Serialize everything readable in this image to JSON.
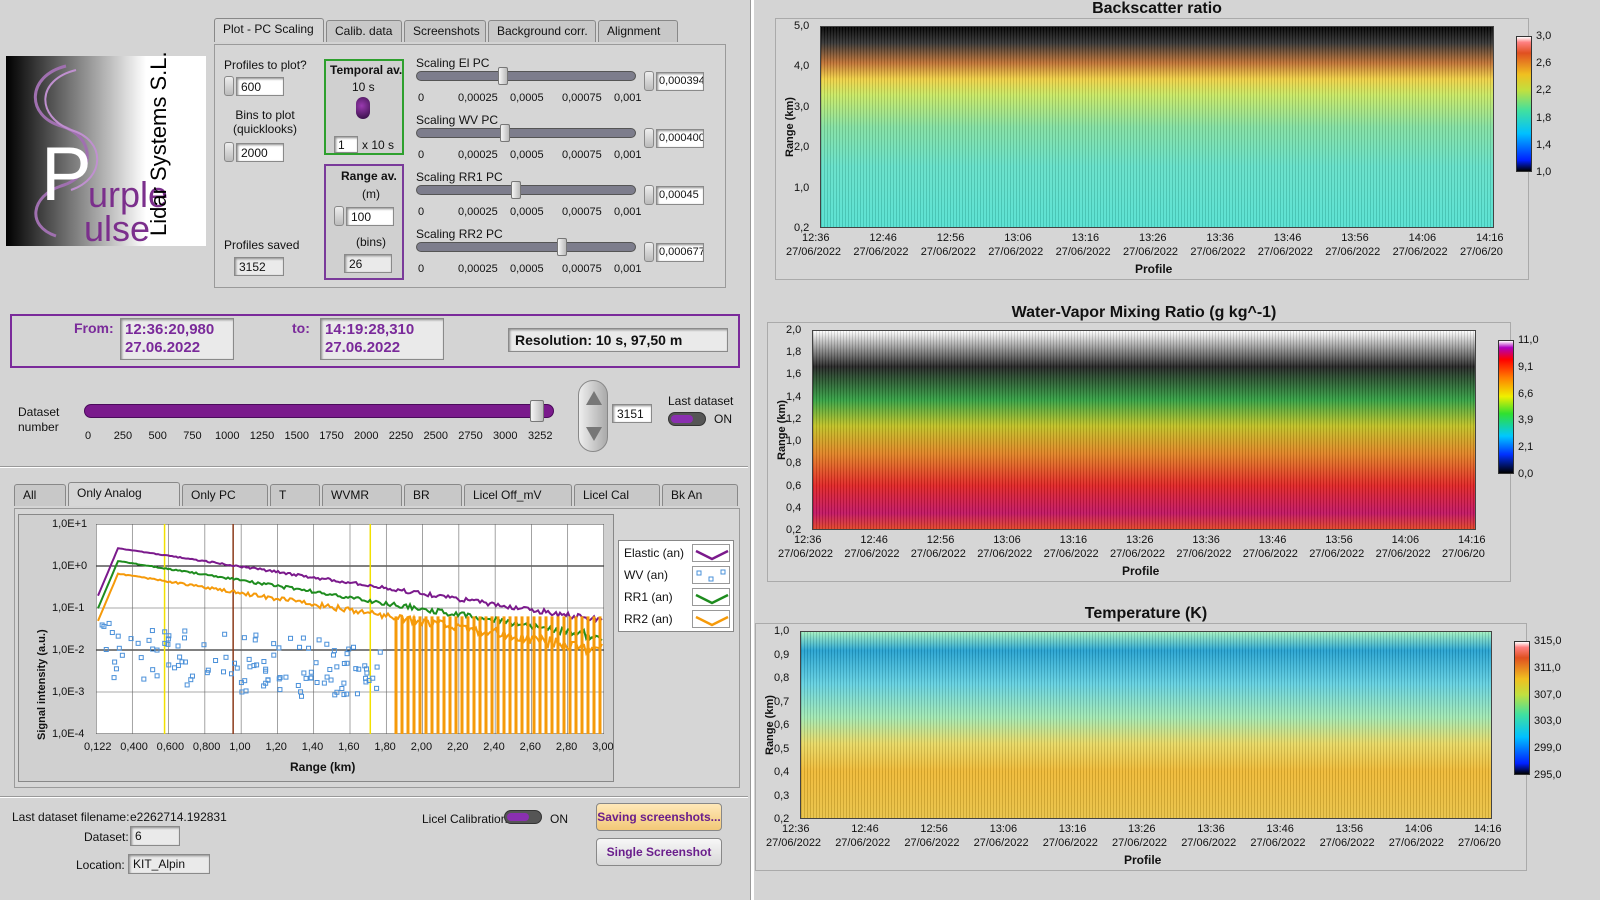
{
  "brand": {
    "logo_line1": "urple",
    "logo_line2": "ulse",
    "logo_letter": "P",
    "company": "Lidar Systems S.L."
  },
  "tabs_top": [
    "Plot - PC Scaling",
    "Calib. data",
    "Screenshots",
    "Background corr.",
    "Alignment"
  ],
  "controls": {
    "profiles_to_plot_label": "Profiles to plot?",
    "profiles_to_plot": "600",
    "bins_to_plot_label": "Bins to plot (quicklooks)",
    "bins_to_plot": "2000",
    "profiles_saved_label": "Profiles saved",
    "profiles_saved": "3152",
    "temporal_av_label": "Temporal av.",
    "temporal_av_value": "10 s",
    "temporal_av_count": "1",
    "temporal_av_unit": "x 10 s",
    "range_av_label": "Range av.",
    "range_av_unit_m": "(m)",
    "range_av_m": "100",
    "range_av_unit_bins": "(bins)",
    "range_av_bins": "26"
  },
  "scalings": [
    {
      "label": "Scaling El PC",
      "value": "0,000394",
      "fraction": 0.39
    },
    {
      "label": "Scaling WV PC",
      "value": "0,000400",
      "fraction": 0.4
    },
    {
      "label": "Scaling RR1 PC",
      "value": "0,00045",
      "fraction": 0.45
    },
    {
      "label": "Scaling RR2 PC",
      "value": "0,000677",
      "fraction": 0.67
    }
  ],
  "scaling_ticks": [
    "0",
    "0,00025",
    "0,0005",
    "0,00075",
    "0,001"
  ],
  "time_range": {
    "from_label": "From:",
    "from_time": "12:36:20,980",
    "from_date": "27.06.2022",
    "to_label": "to:",
    "to_time": "14:19:28,310",
    "to_date": "27.06.2022",
    "resolution": "Resolution: 10 s, 97,50 m"
  },
  "dataset": {
    "label": "Dataset number",
    "value": "3151",
    "max": 3252,
    "ticks": [
      "0",
      "250",
      "500",
      "750",
      "1000",
      "1250",
      "1500",
      "1750",
      "2000",
      "2250",
      "2500",
      "2750",
      "3000",
      "3252"
    ],
    "last_label": "Last dataset",
    "last_state": "ON"
  },
  "tabs_bottom": [
    "All",
    "Only Analog",
    "Only PC",
    "T",
    "WVMR",
    "BR",
    "Licel Off_mV",
    "Licel Cal",
    "Bk An"
  ],
  "signal_plot": {
    "ylabel": "Signal intensity (a.u.)",
    "xlabel": "Range (km)",
    "yticks": [
      "1,0E+1",
      "1,0E+0",
      "1,0E-1",
      "1,0E-2",
      "1,0E-3",
      "1,0E-4"
    ],
    "xticks": [
      "0,122",
      "0,400",
      "0,600",
      "0,800",
      "1,00",
      "1,20",
      "1,40",
      "1,60",
      "1,80",
      "2,00",
      "2,20",
      "2,40",
      "2,60",
      "2,80",
      "3,00"
    ],
    "legend": [
      {
        "name": "Elastic (an)",
        "color": "#7b1a8c"
      },
      {
        "name": "WV (an)",
        "color": "#4a90d9"
      },
      {
        "name": "RR1 (an)",
        "color": "#1e8c1e"
      },
      {
        "name": "RR2 (an)",
        "color": "#f59a0a"
      }
    ]
  },
  "footer": {
    "filename_label": "Last dataset filename:",
    "filename": "e2262714.192831",
    "dataset_label": "Dataset:",
    "dataset": "6",
    "location_label": "Location:",
    "location": "KIT_Alpin",
    "licel_label": "Licel Calibration",
    "licel_state": "ON",
    "saving_btn": "Saving screenshots...",
    "single_btn": "Single Screenshot"
  },
  "time_ticks": [
    "12:36",
    "12:46",
    "12:56",
    "13:06",
    "13:16",
    "13:26",
    "13:36",
    "13:46",
    "13:56",
    "14:06",
    "14:16"
  ],
  "time_date": "27/06/2022",
  "time_date_last": "27/06/20",
  "xlabel": "Profile",
  "ylabel": "Range (km)",
  "backscatter": {
    "title": "Backscatter ratio",
    "yticks": [
      "5,0",
      "4,0",
      "3,0",
      "2,0",
      "1,0",
      "0,2"
    ],
    "cticks": [
      "3,0",
      "2,6",
      "2,2",
      "1,8",
      "1,4",
      "1,0"
    ]
  },
  "wvmr": {
    "title": "Water-Vapor Mixing Ratio  (g kg^-1)",
    "yticks": [
      "2,0",
      "1,8",
      "1,6",
      "1,4",
      "1,2",
      "1,0",
      "0,8",
      "0,6",
      "0,4",
      "0,2"
    ],
    "cticks": [
      "11,0",
      "9,1",
      "6,6",
      "3,9",
      "2,1",
      "0,0"
    ]
  },
  "temperature": {
    "title": "Temperature (K)",
    "yticks": [
      "1,0",
      "0,9",
      "0,8",
      "0,7",
      "0,6",
      "0,5",
      "0,4",
      "0,3",
      "0,2"
    ],
    "cticks": [
      "315,0",
      "311,0",
      "307,0",
      "303,0",
      "299,0",
      "295,0"
    ]
  }
}
